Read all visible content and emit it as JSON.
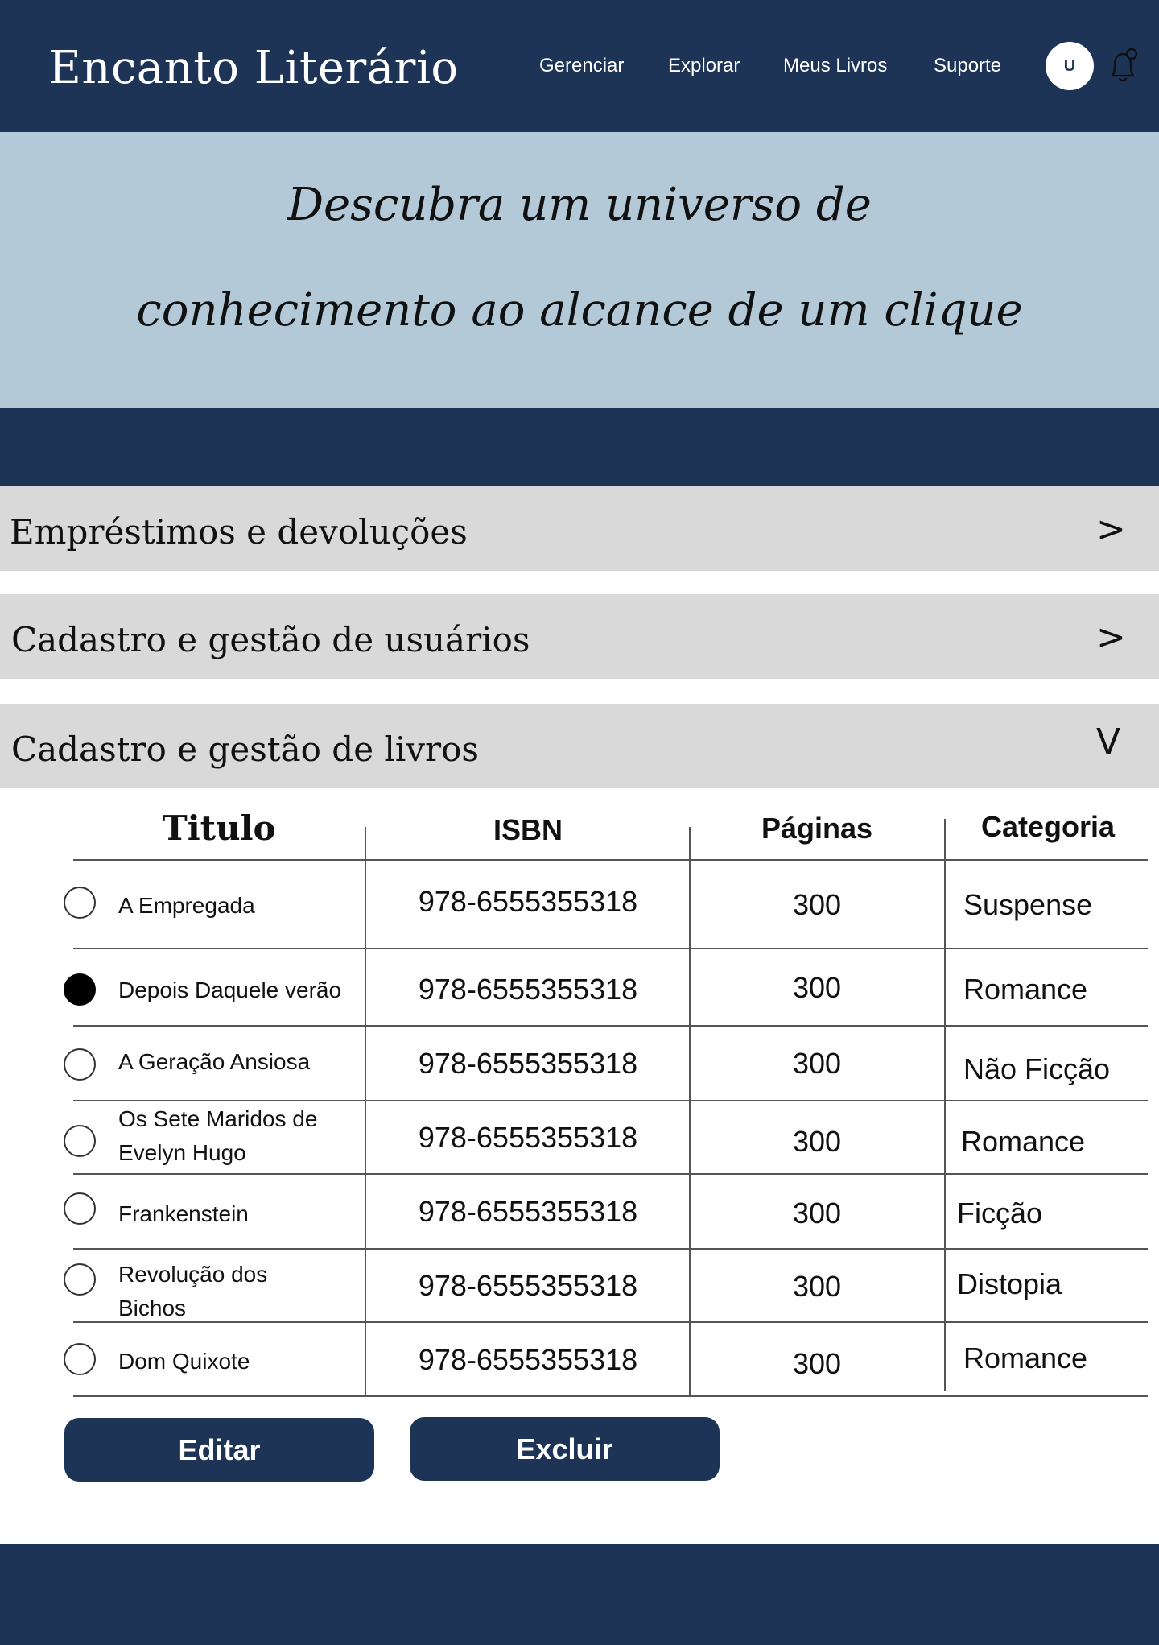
{
  "header": {
    "brand": "Encanto Literário",
    "nav": [
      "Gerenciar",
      "Explorar",
      "Meus Livros",
      "Suporte"
    ],
    "avatar_initial": "U",
    "bg_color": "#1e3456"
  },
  "hero": {
    "line1": "Descubra um universo de",
    "line2": "conhecimento ao alcance de um clique",
    "bg_color": "#b3c9d8"
  },
  "accordion": [
    {
      "title": "Empréstimos e devoluções",
      "arrow": ">",
      "expanded": false
    },
    {
      "title": "Cadastro e gestão de usuários",
      "arrow": ">",
      "expanded": false
    },
    {
      "title": "Cadastro e gestão de livros",
      "arrow": "V",
      "expanded": true
    }
  ],
  "table": {
    "headers": [
      "Titulo",
      "ISBN",
      "Páginas",
      "Categoria"
    ],
    "rows": [
      {
        "title": "A Empregada",
        "isbn": "978-6555355318",
        "pages": "300",
        "category": "Suspense",
        "selected": false
      },
      {
        "title": "Depois Daquele verão",
        "isbn": "978-6555355318",
        "pages": "300",
        "category": "Romance",
        "selected": true
      },
      {
        "title": "A Geração Ansiosa",
        "isbn": "978-6555355318",
        "pages": "300",
        "category": "Não Ficção",
        "selected": false
      },
      {
        "title": "Os Sete Maridos de Evelyn Hugo",
        "isbn": "978-6555355318",
        "pages": "300",
        "category": "Romance",
        "selected": false
      },
      {
        "title": "Frankenstein",
        "isbn": "978-6555355318",
        "pages": "300",
        "category": "Ficção",
        "selected": false
      },
      {
        "title": "Revolução dos Bichos",
        "isbn": "978-6555355318",
        "pages": "300",
        "category": "Distopia",
        "selected": false
      },
      {
        "title": "Dom Quixote",
        "isbn": "978-6555355318",
        "pages": "300",
        "category": "Romance",
        "selected": false
      }
    ]
  },
  "actions": {
    "edit_label": "Editar",
    "delete_label": "Excluir"
  }
}
